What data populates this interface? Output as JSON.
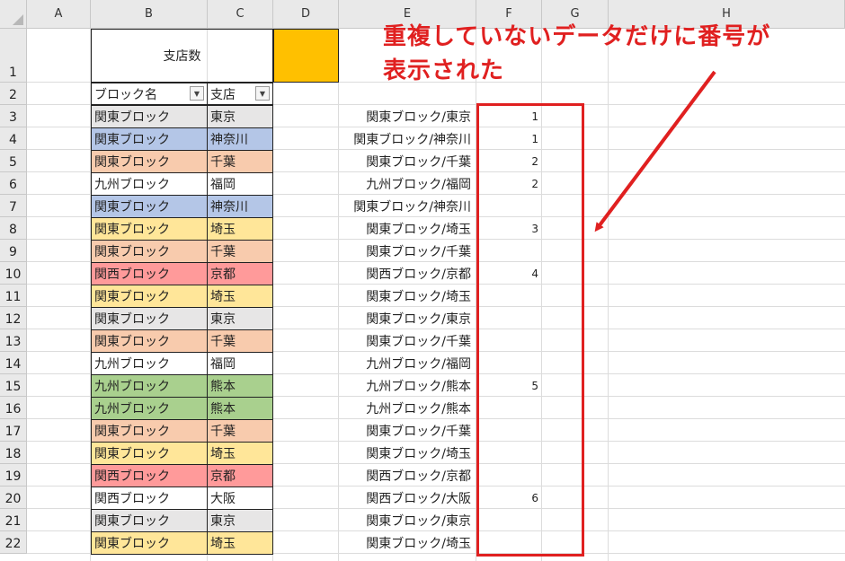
{
  "columns": [
    "A",
    "B",
    "C",
    "D",
    "E",
    "F",
    "G",
    "H"
  ],
  "rows": [
    "1",
    "2",
    "3",
    "4",
    "5",
    "6",
    "7",
    "8",
    "9",
    "10",
    "11",
    "12",
    "13",
    "14",
    "15",
    "16",
    "17",
    "18",
    "19",
    "20",
    "21",
    "22"
  ],
  "merged_title": "支店数",
  "headers": {
    "block": "ブロック名",
    "branch": "支店"
  },
  "annotation": {
    "line1": "重複していないデータだけに番号が",
    "line2": "表示された"
  },
  "colors": {
    "gray": "#e7e6e6",
    "blue": "#b4c6e7",
    "orange": "#f8cbad",
    "yellow": "#ffe699",
    "red": "#ff9a9a",
    "green": "#a9d08e",
    "white": "#ffffff",
    "accent": "#ffc000",
    "annotation": "#e02020"
  },
  "data": [
    {
      "block": "関東ブロック",
      "branch": "東京",
      "color": "gray",
      "combined": "関東ブロック/東京",
      "num": "1"
    },
    {
      "block": "関東ブロック",
      "branch": "神奈川",
      "color": "blue",
      "combined": "関東ブロック/神奈川",
      "num": "1"
    },
    {
      "block": "関東ブロック",
      "branch": "千葉",
      "color": "orange",
      "combined": "関東ブロック/千葉",
      "num": "2"
    },
    {
      "block": "九州ブロック",
      "branch": "福岡",
      "color": "white",
      "combined": "九州ブロック/福岡",
      "num": "2"
    },
    {
      "block": "関東ブロック",
      "branch": "神奈川",
      "color": "blue",
      "combined": "関東ブロック/神奈川",
      "num": ""
    },
    {
      "block": "関東ブロック",
      "branch": "埼玉",
      "color": "yellow",
      "combined": "関東ブロック/埼玉",
      "num": "3"
    },
    {
      "block": "関東ブロック",
      "branch": "千葉",
      "color": "orange",
      "combined": "関東ブロック/千葉",
      "num": ""
    },
    {
      "block": "関西ブロック",
      "branch": "京都",
      "color": "red",
      "combined": "関西ブロック/京都",
      "num": "4"
    },
    {
      "block": "関東ブロック",
      "branch": "埼玉",
      "color": "yellow",
      "combined": "関東ブロック/埼玉",
      "num": ""
    },
    {
      "block": "関東ブロック",
      "branch": "東京",
      "color": "gray",
      "combined": "関東ブロック/東京",
      "num": ""
    },
    {
      "block": "関東ブロック",
      "branch": "千葉",
      "color": "orange",
      "combined": "関東ブロック/千葉",
      "num": ""
    },
    {
      "block": "九州ブロック",
      "branch": "福岡",
      "color": "white",
      "combined": "九州ブロック/福岡",
      "num": ""
    },
    {
      "block": "九州ブロック",
      "branch": "熊本",
      "color": "green",
      "combined": "九州ブロック/熊本",
      "num": "5"
    },
    {
      "block": "九州ブロック",
      "branch": "熊本",
      "color": "green",
      "combined": "九州ブロック/熊本",
      "num": ""
    },
    {
      "block": "関東ブロック",
      "branch": "千葉",
      "color": "orange",
      "combined": "関東ブロック/千葉",
      "num": ""
    },
    {
      "block": "関東ブロック",
      "branch": "埼玉",
      "color": "yellow",
      "combined": "関東ブロック/埼玉",
      "num": ""
    },
    {
      "block": "関西ブロック",
      "branch": "京都",
      "color": "red",
      "combined": "関西ブロック/京都",
      "num": ""
    },
    {
      "block": "関西ブロック",
      "branch": "大阪",
      "color": "white",
      "combined": "関西ブロック/大阪",
      "num": "6"
    },
    {
      "block": "関東ブロック",
      "branch": "東京",
      "color": "gray",
      "combined": "関東ブロック/東京",
      "num": ""
    },
    {
      "block": "関東ブロック",
      "branch": "埼玉",
      "color": "yellow",
      "combined": "関東ブロック/埼玉",
      "num": ""
    }
  ]
}
